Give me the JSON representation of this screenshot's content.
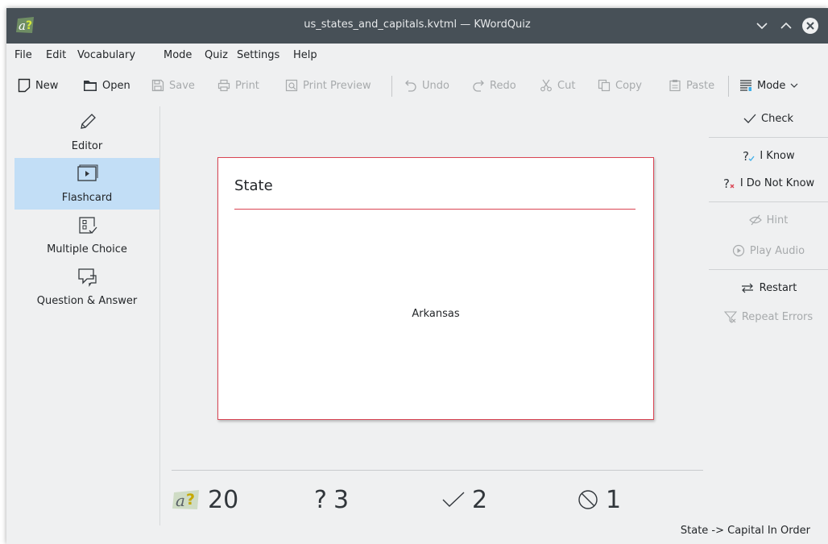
{
  "window": {
    "title": "us_states_and_capitals.kvtml — KWordQuiz",
    "app_icon": "kwordquiz-icon",
    "controls": [
      "minimize-icon",
      "maximize-icon",
      "close-icon"
    ]
  },
  "menubar": {
    "items": [
      "File",
      "Edit",
      "Vocabulary",
      "Mode",
      "Quiz",
      "Settings",
      "Help"
    ]
  },
  "toolbar": {
    "new": "New",
    "open": "Open",
    "save": "Save",
    "print": "Print",
    "print_preview": "Print Preview",
    "undo": "Undo",
    "redo": "Redo",
    "cut": "Cut",
    "copy": "Copy",
    "paste": "Paste",
    "mode": "Mode"
  },
  "sidebar": {
    "items": [
      {
        "label": "Editor",
        "icon": "pencil-icon",
        "active": false
      },
      {
        "label": "Flashcard",
        "icon": "flashcard-icon",
        "active": true
      },
      {
        "label": "Multiple Choice",
        "icon": "multiple-choice-icon",
        "active": false
      },
      {
        "label": "Question & Answer",
        "icon": "question-answer-icon",
        "active": false
      }
    ]
  },
  "card": {
    "title": "State",
    "word": "Arkansas"
  },
  "scores": {
    "total": "20",
    "wrong": "3",
    "correct": "2",
    "skipped": "1"
  },
  "actions": {
    "check": "Check",
    "i_know": "I Know",
    "i_do_not_know": "I Do Not Know",
    "hint": "Hint",
    "play_audio": "Play Audio",
    "restart": "Restart",
    "repeat_errors": "Repeat Errors"
  },
  "status": "State -> Capital In Order",
  "colors": {
    "titlebar": "#475057",
    "accent_red": "#da4453",
    "selection": "#c2def6",
    "disabled": "#a7aaac"
  }
}
